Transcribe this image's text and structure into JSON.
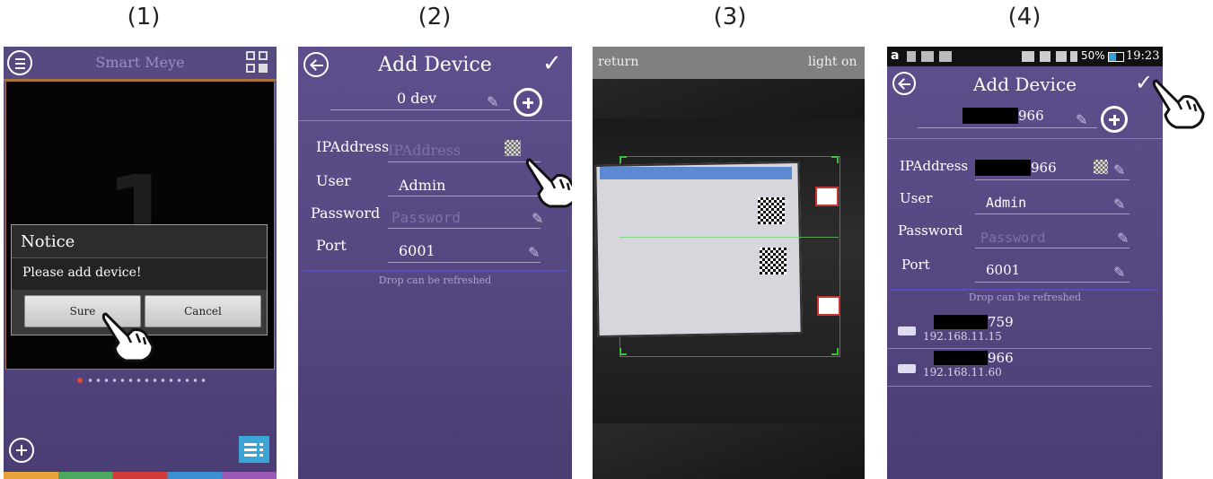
{
  "steps": [
    "(1)",
    "(2)",
    "(3)",
    "(4)"
  ],
  "panel1": {
    "title": "Smart Meye",
    "big_number": "1",
    "notice_title": "Notice",
    "notice_message": "Please add device!",
    "sure_label": "Sure",
    "cancel_label": "Cancel",
    "accent_color": "#e2483b"
  },
  "panel2": {
    "title": "Add Device",
    "device_name": "0 dev",
    "ip_label": "IPAddress",
    "ip_placeholder": "IPAddress",
    "user_label": "User",
    "user_value": "Admin",
    "password_label": "Password",
    "password_placeholder": "Password",
    "port_label": "Port",
    "port_value": "6001",
    "refresh_hint": "Drop can be refreshed"
  },
  "panel3": {
    "return_label": "return",
    "light_label": "light on"
  },
  "panel4": {
    "status_battery": "50%",
    "status_time": "19:23",
    "title": "Add Device",
    "device_name": "966",
    "ip_label": "IPAddress",
    "ip_value": "966",
    "user_label": "User",
    "user_value": "Admin",
    "password_label": "Password",
    "password_placeholder": "Password",
    "port_label": "Port",
    "port_value": "6001",
    "refresh_hint": "Drop can be refreshed",
    "devices": [
      {
        "name": "759",
        "ip": "192.168.11.15"
      },
      {
        "name": "966",
        "ip": "192.168.11.60"
      }
    ]
  }
}
